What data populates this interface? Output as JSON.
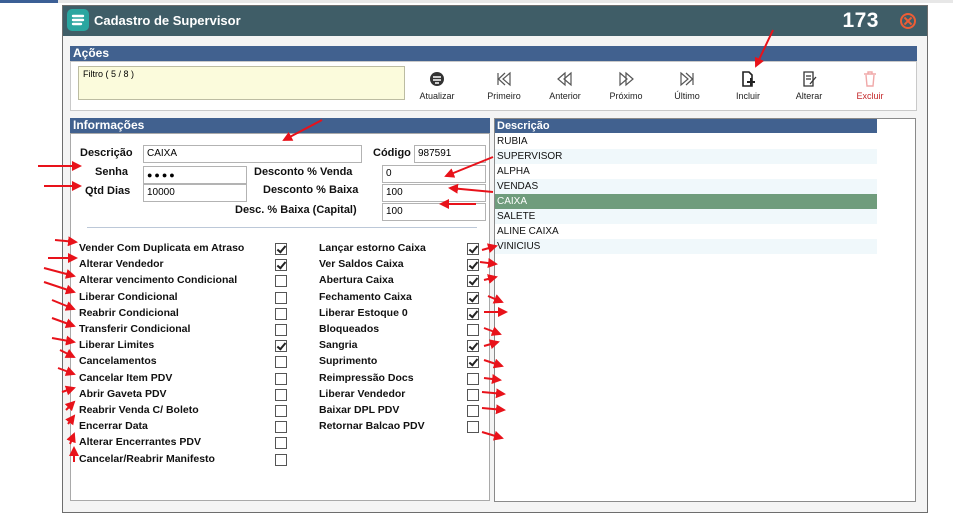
{
  "window": {
    "title": "Cadastro de Supervisor",
    "number": "173"
  },
  "acoes": {
    "header": "Ações",
    "filtro": "Filtro ( 5 / 8 )",
    "buttons": {
      "atualizar": "Atualizar",
      "primeiro": "Primeiro",
      "anterior": "Anterior",
      "proximo": "Próximo",
      "ultimo": "Último",
      "incluir": "Incluir",
      "alterar": "Alterar",
      "excluir": "Excluir"
    }
  },
  "info": {
    "header": "Informações",
    "descricao_label": "Descrição",
    "descricao_value": "CAIXA",
    "codigo_label": "Código",
    "codigo_value": "987591",
    "senha_label": "Senha",
    "senha_value": "●●●●",
    "qtd_dias_label": "Qtd Dias",
    "qtd_dias_value": "10000",
    "desconto_venda_label": "Desconto % Venda",
    "desconto_venda_value": "0",
    "desconto_baixa_label": "Desconto % Baixa",
    "desconto_baixa_value": "100",
    "desc_baixa_capital_label": "Desc. % Baixa (Capital)",
    "desc_baixa_capital_value": "100"
  },
  "permissions_left": [
    {
      "label": "Vender Com Duplicata em Atraso",
      "checked": true
    },
    {
      "label": "Alterar Vendedor",
      "checked": true
    },
    {
      "label": "Alterar vencimento Condicional",
      "checked": false
    },
    {
      "label": "Liberar Condicional",
      "checked": false
    },
    {
      "label": "Reabrir Condicional",
      "checked": false
    },
    {
      "label": "Transferir Condicional",
      "checked": false
    },
    {
      "label": "Liberar Limites",
      "checked": true
    },
    {
      "label": "Cancelamentos",
      "checked": false
    },
    {
      "label": "Cancelar Item PDV",
      "checked": false
    },
    {
      "label": "Abrir Gaveta PDV",
      "checked": false
    },
    {
      "label": "Reabrir Venda C/ Boleto",
      "checked": false
    },
    {
      "label": "Encerrar Data",
      "checked": false
    },
    {
      "label": "Alterar Encerrantes PDV",
      "checked": false
    },
    {
      "label": "Cancelar/Reabrir Manifesto",
      "checked": false
    }
  ],
  "permissions_right": [
    {
      "label": "Lançar estorno Caixa",
      "checked": true
    },
    {
      "label": "Ver Saldos Caixa",
      "checked": true
    },
    {
      "label": "Abertura Caixa",
      "checked": true
    },
    {
      "label": "Fechamento Caixa",
      "checked": true
    },
    {
      "label": "Liberar Estoque 0",
      "checked": true
    },
    {
      "label": "Bloqueados",
      "checked": false
    },
    {
      "label": "Sangria",
      "checked": true
    },
    {
      "label": "Suprimento",
      "checked": true
    },
    {
      "label": "Reimpressão Docs",
      "checked": false
    },
    {
      "label": "Liberar Vendedor",
      "checked": false
    },
    {
      "label": "Baixar DPL PDV",
      "checked": false
    },
    {
      "label": "Retornar Balcao PDV",
      "checked": false
    }
  ],
  "descricao_list": {
    "header": "Descrição",
    "items": [
      "RUBIA",
      "SUPERVISOR",
      "ALPHA",
      "VENDAS",
      "CAIXA",
      "SALETE",
      "ALINE CAIXA",
      "VINICIUS"
    ],
    "selected": "CAIXA"
  },
  "colors": {
    "titlebar": "#3f5d67",
    "section_header": "#41618f",
    "selected_row": "#6f9c7c",
    "annotation_arrow": "#e8121a",
    "excluir_label": "#c4282a"
  }
}
